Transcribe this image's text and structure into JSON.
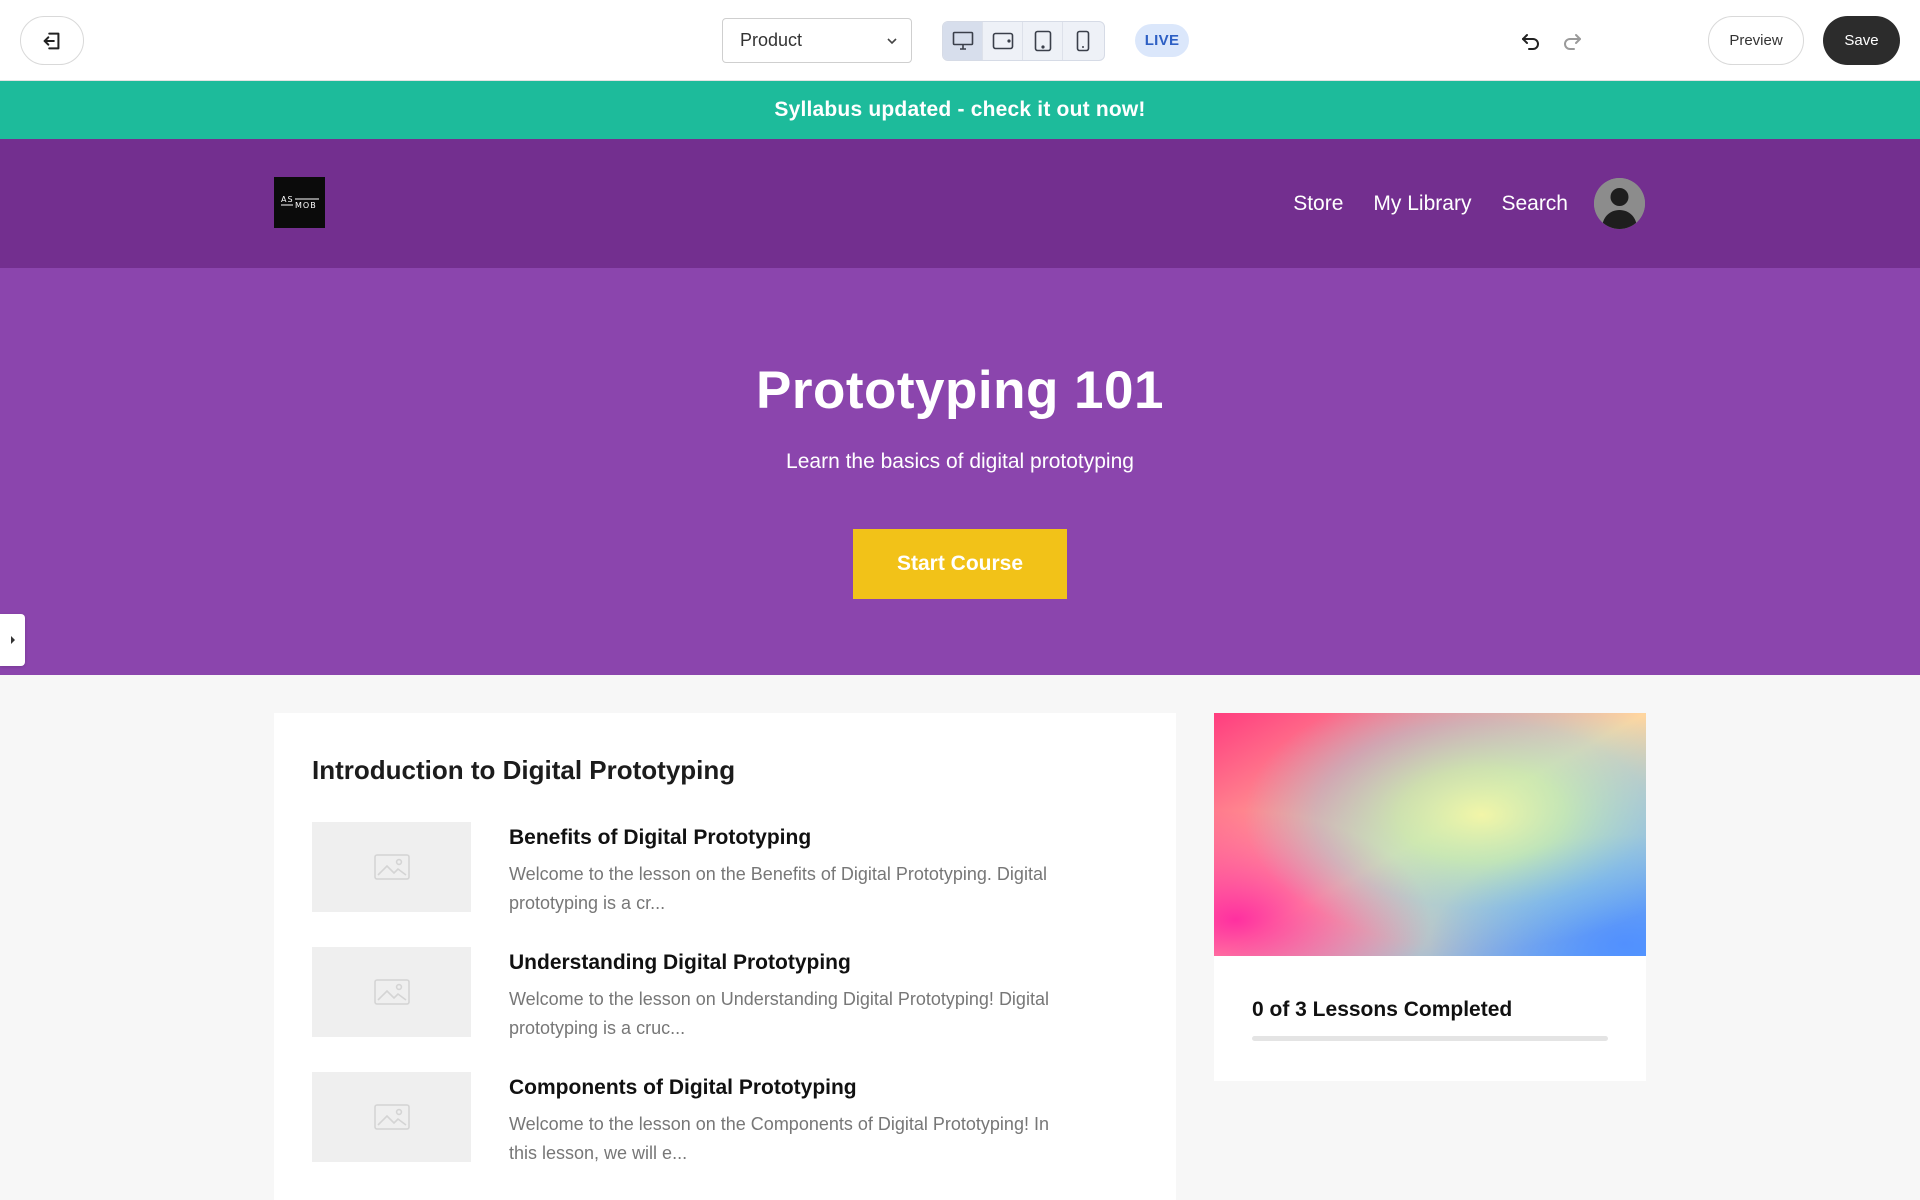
{
  "toolbar": {
    "page_selector": {
      "value": "Product"
    },
    "live_badge": "LIVE",
    "preview_label": "Preview",
    "save_label": "Save",
    "device_buttons": [
      "desktop-icon",
      "tablet-landscape-icon",
      "tablet-portrait-icon",
      "mobile-icon"
    ]
  },
  "site": {
    "announcement": "Syllabus updated - check it out now!",
    "logo_text": "ASMOB",
    "nav": {
      "store": "Store",
      "my_library": "My Library",
      "search": "Search"
    },
    "hero": {
      "title": "Prototyping 101",
      "subtitle": "Learn the basics of digital prototyping",
      "cta": "Start Course"
    },
    "section": {
      "title": "Introduction to Digital Prototyping",
      "lessons": [
        {
          "title": "Benefits of Digital Prototyping",
          "excerpt": "Welcome to the lesson on the Benefits of Digital Prototyping. Digital prototyping is a cr..."
        },
        {
          "title": "Understanding Digital Prototyping",
          "excerpt": "Welcome to the lesson on Understanding Digital Prototyping! Digital prototyping is a cruc..."
        },
        {
          "title": "Components of Digital Prototyping",
          "excerpt": "Welcome to the lesson on the Components of Digital Prototyping! In this lesson, we will e..."
        }
      ]
    },
    "progress": {
      "text": "0 of 3 Lessons Completed",
      "completed": 0,
      "total": 3
    }
  },
  "colors": {
    "announcement": "#1dbb9b",
    "nav": "#732f8f",
    "hero": "#8b45ad",
    "cta": "#f2c218",
    "save": "#2c2c2c",
    "live": "#2d5fc4"
  }
}
